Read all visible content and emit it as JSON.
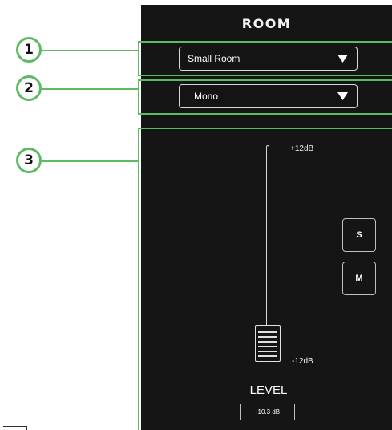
{
  "panel": {
    "title": "ROOM"
  },
  "callouts": [
    {
      "number": "1"
    },
    {
      "number": "2"
    },
    {
      "number": "3"
    }
  ],
  "room_type_dropdown": {
    "selected": "Small Room"
  },
  "channel_mode_dropdown": {
    "selected": "Mono"
  },
  "fader": {
    "max_label": "+12dB",
    "min_label": "-12dB",
    "name": "LEVEL",
    "value": "-10.3 dB",
    "level_fraction": 0.07
  },
  "buttons": {
    "solo_label": "S",
    "mute_label": "M"
  },
  "colors": {
    "callout_green": "#5dbb63",
    "panel_background": "#151515",
    "text": "#f2f2f2"
  },
  "icons": {
    "dropdown_arrow": "triangle-down-icon",
    "fader_knob": "fader-handle-icon"
  }
}
